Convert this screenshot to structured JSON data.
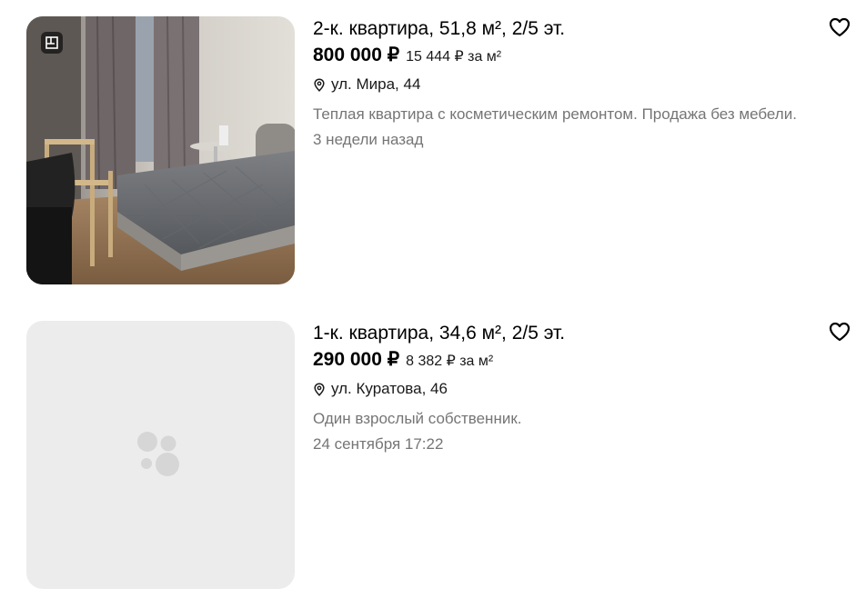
{
  "listings": [
    {
      "title": "2-к. квартира, 51,8 м², 2/5 эт.",
      "price": "800 000 ₽",
      "price_per_m2": "15 444 ₽ за м²",
      "address": "ул. Мира, 44",
      "description": "Теплая квартира с косметическим ремонтом. Продажа без мебели.",
      "date": "3 недели назад",
      "photo": "bedroom-photo",
      "favorite_icon": "heart-outline-icon"
    },
    {
      "title": "1-к. квартира, 34,6 м², 2/5 эт.",
      "price": "290 000 ₽",
      "price_per_m2": "8 382 ₽ за м²",
      "address": "ул. Куратова, 46",
      "description": "Один взрослый собственник.",
      "date": "24 сентября 17:22",
      "photo": "placeholder",
      "favorite_icon": "heart-outline-icon"
    }
  ],
  "colors": {
    "text_primary": "#000000",
    "text_secondary": "#757575",
    "placeholder_bg": "#ececec",
    "placeholder_dots": "#d6d6d6"
  }
}
